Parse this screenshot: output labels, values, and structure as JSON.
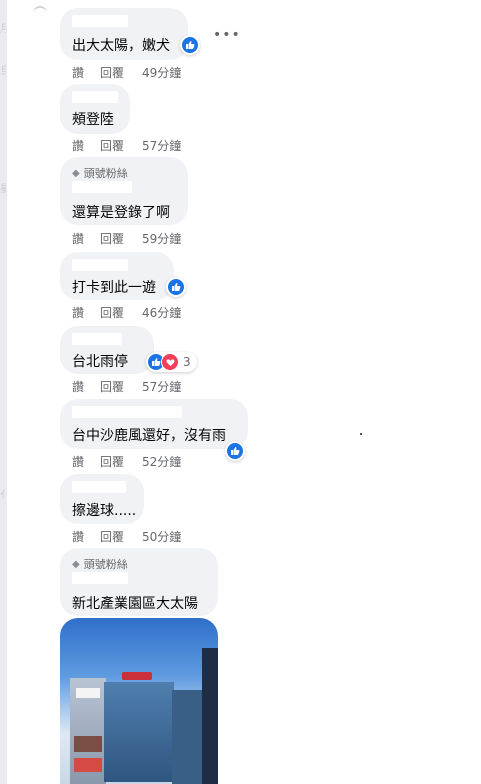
{
  "colors": {
    "bubble": "#f0f2f5",
    "like_blue": "#1b74e4",
    "love_red": "#f33e58",
    "meta_text": "#65676b"
  },
  "comments": [
    {
      "badge": "",
      "text": "出大太陽，嫩犬",
      "like_label": "讚",
      "reply_label": "回覆",
      "time": "49分鐘",
      "reactions": [
        "like-icon"
      ],
      "reaction_count": ""
    },
    {
      "badge": "",
      "text": "頰登陸",
      "like_label": "讚",
      "reply_label": "回覆",
      "time": "57分鐘",
      "reactions": [],
      "reaction_count": ""
    },
    {
      "badge": "頭號粉絲",
      "text": "還算是登錄了啊",
      "like_label": "讚",
      "reply_label": "回覆",
      "time": "59分鐘",
      "reactions": [],
      "reaction_count": ""
    },
    {
      "badge": "",
      "text": "打卡到此一遊",
      "like_label": "讚",
      "reply_label": "回覆",
      "time": "46分鐘",
      "reactions": [
        "like-icon"
      ],
      "reaction_count": ""
    },
    {
      "badge": "",
      "text": "台北雨停",
      "like_label": "讚",
      "reply_label": "回覆",
      "time": "57分鐘",
      "reactions": [
        "like-icon",
        "love-icon"
      ],
      "reaction_count": "3"
    },
    {
      "badge": "",
      "text": "台中沙鹿風還好，沒有雨",
      "like_label": "讚",
      "reply_label": "回覆",
      "time": "52分鐘",
      "reactions": [
        "like-icon"
      ],
      "reaction_count": ""
    },
    {
      "badge": "",
      "text": "擦邊球.....",
      "like_label": "讚",
      "reply_label": "回覆",
      "time": "50分鐘",
      "reactions": [],
      "reaction_count": ""
    },
    {
      "badge": "頭號粉絲",
      "text": "新北產業園區大太陽",
      "like_label": "",
      "reply_label": "",
      "time": "",
      "reactions": [],
      "reaction_count": ""
    }
  ],
  "more_icon": "more-options-icon",
  "photo": {
    "description_icon": "photo-attachment"
  }
}
